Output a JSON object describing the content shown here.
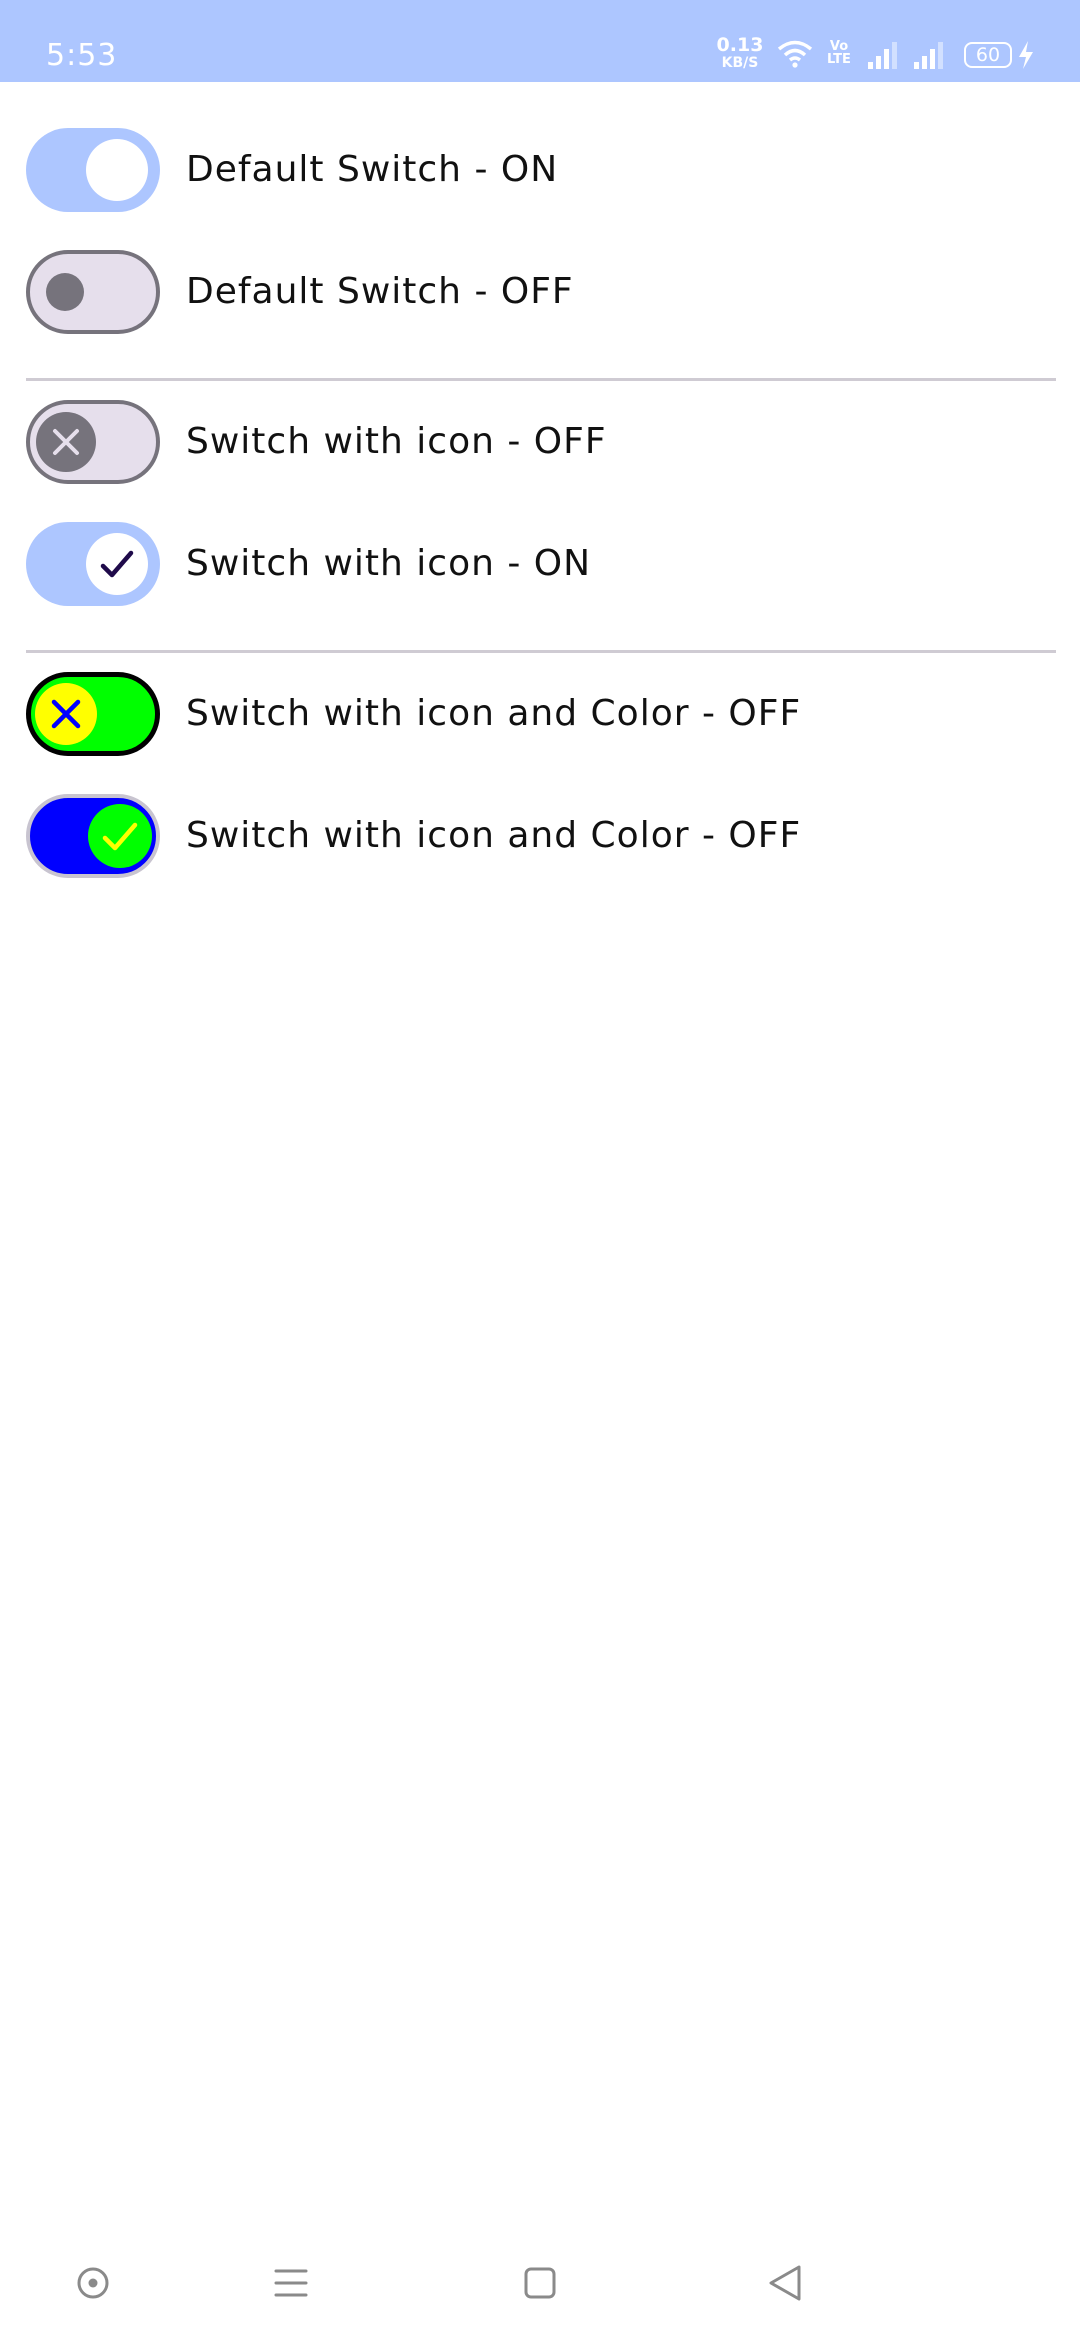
{
  "status_bar": {
    "time": "5:53",
    "net_speed_value": "0.13",
    "net_speed_unit": "KB/S",
    "volte_line1": "Vo",
    "volte_line2": "LTE",
    "battery": "60",
    "background": "#adc6ff",
    "icons": [
      "wifi-icon",
      "volte-icon",
      "signal-icon",
      "signal-icon",
      "battery-icon",
      "charging-bolt-icon"
    ]
  },
  "switches": [
    {
      "label": "Default Switch - ON",
      "checked": true,
      "thumb_icon": null
    },
    {
      "label": "Default Switch - OFF",
      "checked": false,
      "thumb_icon": null
    },
    {
      "label": "Switch with icon - OFF",
      "checked": false,
      "thumb_icon": "close-icon"
    },
    {
      "label": "Switch with icon - ON",
      "checked": true,
      "thumb_icon": "check-icon"
    },
    {
      "label": "Switch with icon and Color - OFF",
      "checked": false,
      "thumb_icon": "close-icon"
    },
    {
      "label": "Switch with icon and Color - OFF",
      "checked": true,
      "thumb_icon": "check-icon"
    }
  ],
  "colors": {
    "primary_track": "#adc6ff",
    "off_track": "#e6dfec",
    "off_outline": "#76737c",
    "custom_off_track": "#00ff00",
    "custom_off_thumb": "#ffff00",
    "custom_off_icon": "#0000ff",
    "custom_on_track": "#0000ff",
    "custom_on_thumb": "#00ff00",
    "custom_on_icon": "#ffff00"
  },
  "nav_bar": {
    "icons": [
      "assistant-icon",
      "menu-icon",
      "home-icon",
      "back-icon"
    ]
  }
}
